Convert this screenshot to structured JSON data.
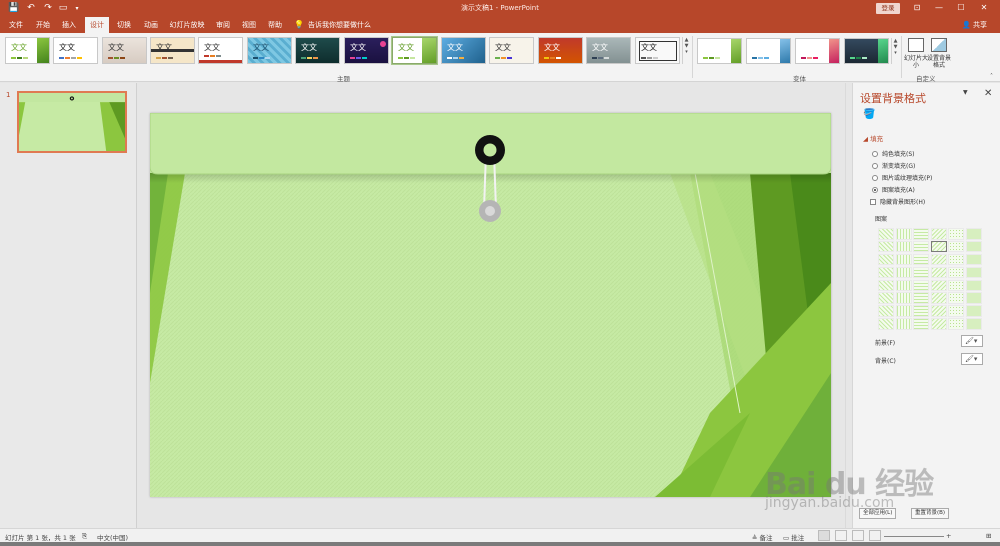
{
  "titlebar": {
    "doc_title": "演示文稿1  -  PowerPoint",
    "login": "登录",
    "qat_save": "💾",
    "qat_undo": "↶",
    "qat_redo": "↷",
    "qat_present": "▭",
    "qat_more": "▾",
    "ribbon_display": "⊡",
    "minimize": "—",
    "maximize": "☐",
    "close": "✕"
  },
  "tabs": [
    {
      "label": "文件"
    },
    {
      "label": "开始"
    },
    {
      "label": "插入"
    },
    {
      "label": "设计",
      "active": true
    },
    {
      "label": "切换"
    },
    {
      "label": "动画"
    },
    {
      "label": "幻灯片放映"
    },
    {
      "label": "审阅"
    },
    {
      "label": "视图"
    },
    {
      "label": "帮助"
    },
    {
      "label": "告诉我你想要做什么"
    }
  ],
  "share": "共享",
  "ribbon": {
    "themes_group": "主题",
    "variants_group": "变体",
    "customize_group": "自定义",
    "theme_text": "文文",
    "slide_size_label": "幻灯片大小",
    "format_bg_label": "设置背景格式"
  },
  "slide_panel": {
    "slide_number": "1"
  },
  "format_pane": {
    "title": "设置背景格式",
    "fill_section": "填充",
    "options": [
      {
        "label": "纯色填充(S)",
        "checked": false
      },
      {
        "label": "渐变填充(G)",
        "checked": false
      },
      {
        "label": "图片或纹理填充(P)",
        "checked": false
      },
      {
        "label": "图案填充(A)",
        "checked": true
      }
    ],
    "hide_graphics": "隐藏背景图形(H)",
    "pattern_label": "图案",
    "foreground_label": "前景(F)",
    "background_label": "背景(C)",
    "apply_all": "全部应用(L)",
    "reset": "重置背景(B)"
  },
  "statusbar": {
    "slide_info": "幻灯片 第 1 张，共 1 张",
    "language": "中文(中国)",
    "notes": "备注",
    "comments": "批注"
  },
  "watermark": {
    "main": "Bai du 经验",
    "sub": "jingyan.baidu.com"
  },
  "colors": {
    "accent": "#b7472a",
    "slide_bg": "#c6eaa4",
    "slide_green_dark": "#5e9a22",
    "slide_green_mid": "#8cc63f"
  }
}
